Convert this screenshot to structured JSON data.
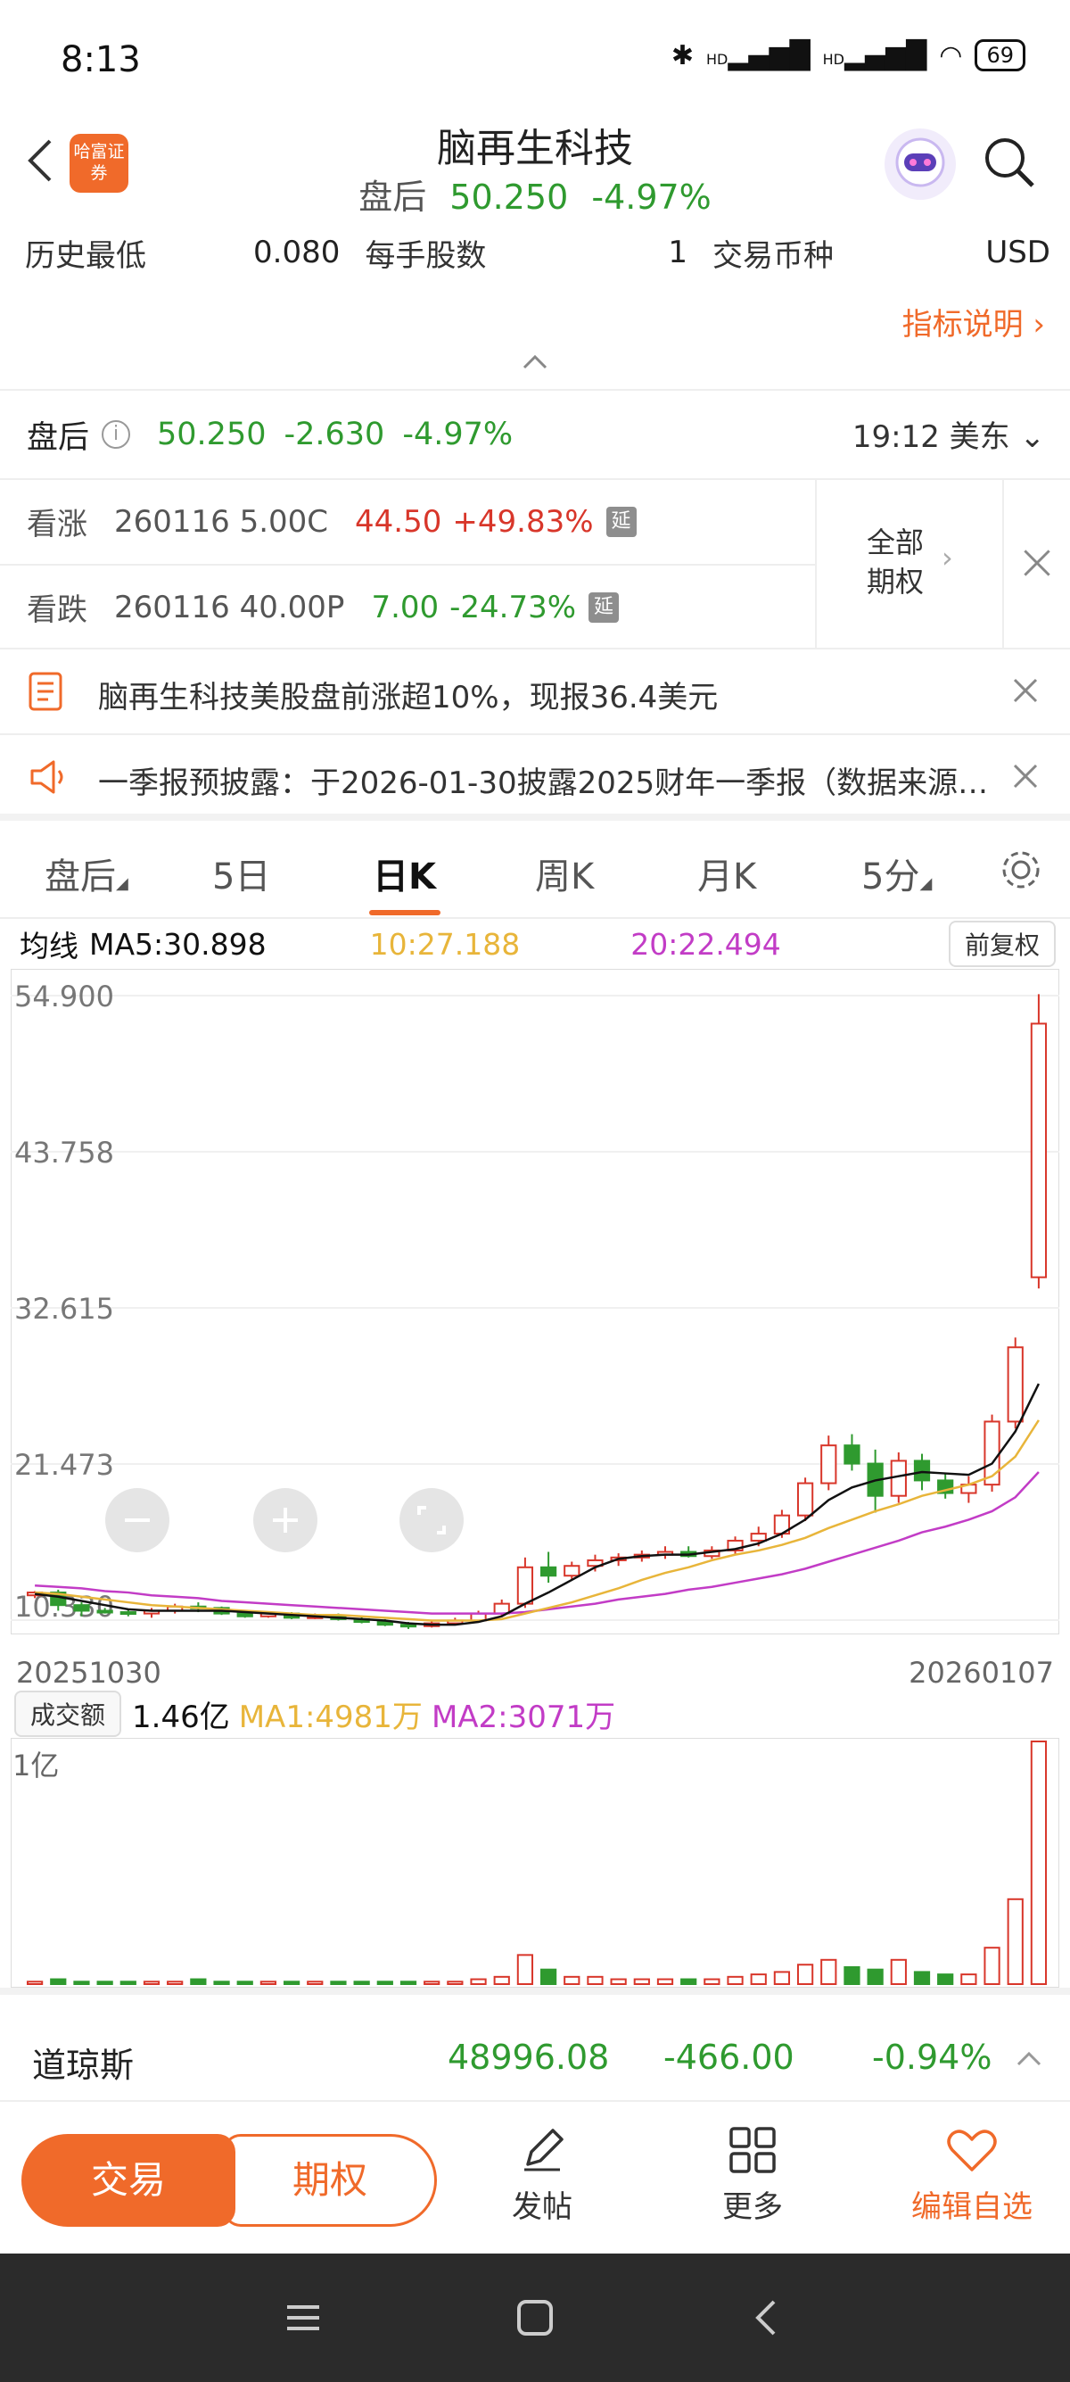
{
  "status": {
    "time": "8:13",
    "signal1": "HD",
    "signal2": "HD",
    "battery": "69"
  },
  "header": {
    "logo_text": "哈富证券",
    "title": "脑再生科技",
    "session": "盘后",
    "price": "50.250",
    "change_pct": "-4.97%"
  },
  "info": {
    "low_label": "历史最低",
    "low_value": "0.080",
    "lot_label": "每手股数",
    "lot_value": "1",
    "currency_label": "交易币种",
    "currency_value": "USD",
    "indicator_link": "指标说明"
  },
  "after_hours": {
    "label": "盘后",
    "price": "50.250",
    "change": "-2.630",
    "change_pct": "-4.97%",
    "time": "19:12 美东"
  },
  "options": {
    "call_label": "看涨",
    "call_contract": "260116 5.00C",
    "call_price": "44.50",
    "call_change": "+49.83%",
    "put_label": "看跌",
    "put_contract": "260116 40.00P",
    "put_price": "7.00",
    "put_change": "-24.73%",
    "delay_tag": "延",
    "all_line1": "全部",
    "all_line2": "期权"
  },
  "news": [
    {
      "text": "脑再生科技美股盘前涨超10%，现报36.4美元"
    },
    {
      "text": "一季报预披露：于2026-01-30披露2025财年一季报（数据来源…"
    }
  ],
  "tabs": [
    "盘后",
    "5日",
    "日K",
    "周K",
    "月K",
    "5分"
  ],
  "ma": {
    "label": "均线",
    "ma5": "MA5:30.898",
    "ma10": "10:27.188",
    "ma20": "20:22.494",
    "adjust_button": "前复权"
  },
  "chart_axis": {
    "y1": "54.900",
    "y2": "43.758",
    "y3": "32.615",
    "y4": "21.473",
    "y5": "10.330",
    "date_start": "20251030",
    "date_end": "20260107"
  },
  "volume": {
    "button": "成交额",
    "value": "1.46亿",
    "ma1": "MA1:4981万",
    "ma2": "MA2:3071万",
    "axis_label": "1亿"
  },
  "index": {
    "name": "道琼斯",
    "value": "48996.08",
    "change": "-466.00",
    "change_pct": "-0.94%"
  },
  "actions": {
    "trade": "交易",
    "option": "期权",
    "post": "发帖",
    "more": "更多",
    "watchlist": "编辑自选"
  },
  "colors": {
    "accent": "#f06a2a",
    "up": "#d8362a",
    "down": "#2f9a2f",
    "ma10": "#e8b53a",
    "ma20": "#c23cc6"
  },
  "chart_data": {
    "type": "candlestick",
    "ylim": [
      10.33,
      54.9
    ],
    "candles": [
      [
        12.1,
        12.4,
        11.9,
        12.3
      ],
      [
        12.3,
        12.5,
        11.0,
        11.4
      ],
      [
        11.4,
        11.6,
        10.6,
        11.0
      ],
      [
        11.0,
        11.2,
        10.8,
        10.9
      ],
      [
        10.9,
        11.1,
        10.6,
        10.8
      ],
      [
        10.8,
        11.2,
        10.5,
        11.0
      ],
      [
        11.0,
        11.5,
        10.8,
        11.3
      ],
      [
        11.3,
        11.6,
        10.9,
        11.2
      ],
      [
        11.2,
        11.3,
        10.7,
        10.8
      ],
      [
        10.8,
        11.0,
        10.5,
        10.6
      ],
      [
        10.6,
        10.9,
        10.5,
        10.8
      ],
      [
        10.8,
        10.9,
        10.4,
        10.5
      ],
      [
        10.5,
        10.8,
        10.4,
        10.6
      ],
      [
        10.6,
        10.8,
        10.3,
        10.4
      ],
      [
        10.4,
        10.6,
        10.1,
        10.2
      ],
      [
        10.2,
        10.4,
        9.9,
        10.0
      ],
      [
        10.0,
        10.2,
        9.7,
        9.9
      ],
      [
        9.9,
        10.3,
        9.8,
        10.1
      ],
      [
        10.1,
        10.5,
        10.0,
        10.3
      ],
      [
        10.3,
        11.0,
        10.2,
        10.8
      ],
      [
        10.8,
        11.8,
        10.6,
        11.5
      ],
      [
        11.5,
        14.8,
        11.2,
        14.1
      ],
      [
        14.1,
        15.2,
        13.0,
        13.5
      ],
      [
        13.5,
        14.5,
        13.2,
        14.2
      ],
      [
        14.2,
        15.0,
        13.8,
        14.6
      ],
      [
        14.6,
        15.1,
        14.2,
        14.8
      ],
      [
        14.8,
        15.3,
        14.5,
        15.0
      ],
      [
        15.0,
        15.6,
        14.7,
        15.2
      ],
      [
        15.2,
        15.6,
        14.8,
        14.9
      ],
      [
        14.9,
        15.6,
        14.7,
        15.3
      ],
      [
        15.3,
        16.3,
        15.0,
        16.0
      ],
      [
        16.0,
        17.0,
        15.6,
        16.5
      ],
      [
        16.5,
        18.2,
        16.2,
        17.8
      ],
      [
        17.8,
        20.5,
        17.4,
        20.1
      ],
      [
        20.1,
        23.5,
        19.6,
        22.8
      ],
      [
        22.8,
        23.6,
        21.0,
        21.5
      ],
      [
        21.5,
        22.5,
        18.0,
        19.2
      ],
      [
        19.2,
        22.3,
        18.7,
        21.7
      ],
      [
        21.7,
        22.2,
        19.6,
        20.3
      ],
      [
        20.3,
        20.8,
        19.0,
        19.4
      ],
      [
        19.4,
        20.6,
        18.7,
        20.0
      ],
      [
        20.0,
        25.0,
        19.5,
        24.5
      ],
      [
        24.5,
        30.5,
        24.0,
        29.8
      ],
      [
        34.8,
        55.0,
        34.0,
        52.9
      ]
    ],
    "ma5": [
      12.2,
      12.0,
      11.7,
      11.4,
      11.1,
      11.0,
      11.0,
      11.0,
      11.0,
      10.9,
      10.8,
      10.7,
      10.6,
      10.5,
      10.4,
      10.3,
      10.1,
      10.0,
      10.0,
      10.2,
      10.6,
      11.5,
      12.3,
      13.2,
      14.1,
      14.7,
      14.9,
      15.0,
      15.0,
      15.2,
      15.4,
      15.8,
      16.5,
      17.5,
      18.9,
      19.8,
      20.3,
      20.6,
      20.9,
      20.8,
      20.7,
      21.5,
      23.8,
      27.2
    ],
    "ma10": [
      12.3,
      12.2,
      12.0,
      11.8,
      11.6,
      11.4,
      11.3,
      11.2,
      11.1,
      11.0,
      10.9,
      10.8,
      10.7,
      10.7,
      10.6,
      10.5,
      10.4,
      10.3,
      10.3,
      10.3,
      10.4,
      10.8,
      11.2,
      11.6,
      12.1,
      12.6,
      13.2,
      13.7,
      14.1,
      14.6,
      15.0,
      15.3,
      15.7,
      16.2,
      16.9,
      17.5,
      18.1,
      18.6,
      19.2,
      19.6,
      20.0,
      20.6,
      22.0,
      24.6
    ],
    "ma20": [
      12.8,
      12.7,
      12.6,
      12.4,
      12.3,
      12.1,
      12.0,
      11.9,
      11.7,
      11.6,
      11.5,
      11.4,
      11.3,
      11.2,
      11.1,
      11.0,
      10.9,
      10.8,
      10.8,
      10.8,
      10.8,
      10.9,
      11.1,
      11.3,
      11.5,
      11.8,
      12.0,
      12.2,
      12.5,
      12.7,
      13.0,
      13.3,
      13.6,
      14.0,
      14.5,
      15.0,
      15.5,
      16.0,
      16.6,
      17.0,
      17.5,
      18.1,
      19.1,
      20.9
    ],
    "volume": [
      0.01,
      0.02,
      0.01,
      0.01,
      0.01,
      0.01,
      0.01,
      0.02,
      0.01,
      0.01,
      0.01,
      0.01,
      0.01,
      0.01,
      0.01,
      0.01,
      0.01,
      0.01,
      0.01,
      0.02,
      0.03,
      0.12,
      0.06,
      0.03,
      0.03,
      0.02,
      0.02,
      0.02,
      0.02,
      0.02,
      0.03,
      0.04,
      0.05,
      0.08,
      0.1,
      0.07,
      0.06,
      0.1,
      0.05,
      0.04,
      0.04,
      0.15,
      0.35,
      1.0
    ],
    "volume_up": [
      true,
      false,
      false,
      false,
      false,
      true,
      true,
      false,
      false,
      false,
      true,
      false,
      true,
      false,
      false,
      false,
      false,
      true,
      true,
      true,
      true,
      true,
      false,
      true,
      true,
      true,
      true,
      true,
      false,
      true,
      true,
      true,
      true,
      true,
      true,
      false,
      false,
      true,
      false,
      false,
      true,
      true,
      true,
      true
    ]
  }
}
